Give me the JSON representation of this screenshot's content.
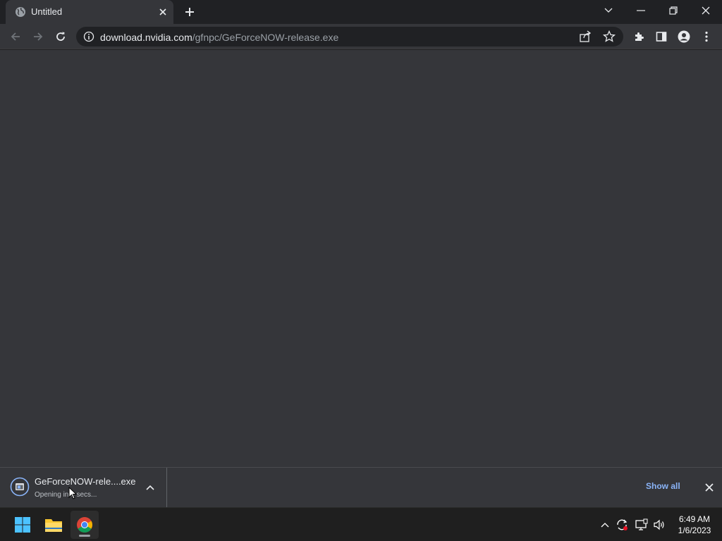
{
  "tab": {
    "title": "Untitled",
    "favicon": "globe-icon"
  },
  "window_controls": [
    "chevron-down-icon",
    "minimize-icon",
    "restore-icon",
    "close-icon"
  ],
  "toolbar": {
    "url_host": "download.nvidia.com",
    "url_path": "/gfnpc/GeForceNOW-release.exe"
  },
  "download": {
    "file_name": "GeForceNOW-rele....exe",
    "status": "Opening in 3 secs...",
    "show_all_label": "Show all"
  },
  "taskbar": {
    "apps": [
      "start-icon",
      "file-explorer-icon",
      "chrome-icon"
    ],
    "clock_time": "6:49 AM",
    "clock_date": "1/6/2023"
  },
  "colors": {
    "tabstrip_bg": "#202124",
    "toolbar_bg": "#35363a",
    "link_blue": "#8ab4f8",
    "taskbar_bg": "#1f1f1f"
  }
}
